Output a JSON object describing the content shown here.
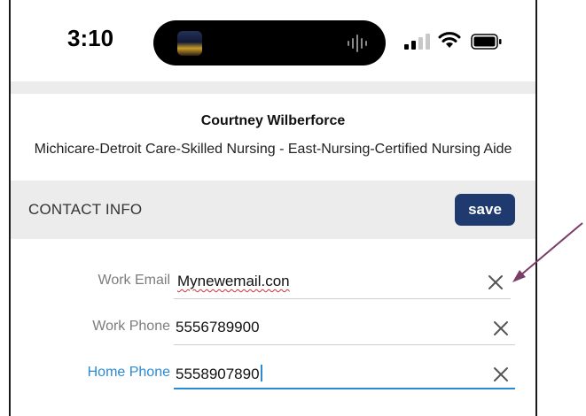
{
  "status_bar": {
    "time": "3:10",
    "icons": [
      "app-thumbnail-icon",
      "audio-wave-icon",
      "cellular-signal-icon",
      "wifi-icon",
      "battery-icon"
    ]
  },
  "profile": {
    "name": "Courtney Wilberforce",
    "organization": "Michicare-Detroit Care-Skilled Nursing - East-Nursing-Certified Nursing Aide"
  },
  "contact_section": {
    "title": "CONTACT INFO",
    "save_label": "save",
    "fields": [
      {
        "label": "Work Email",
        "value": "Mynewemail.con",
        "focused": false,
        "spellcheck_error": true
      },
      {
        "label": "Work Phone",
        "value": "5556789900",
        "focused": false
      },
      {
        "label": "Home Phone",
        "value": "5558907890",
        "focused": true
      }
    ]
  },
  "annotation": {
    "type": "arrow",
    "color": "#7a3d6a",
    "points_to": "work-email-clear-icon"
  },
  "colors": {
    "accent": "#2a8bd3",
    "save_button": "#1f3a6e",
    "section_background": "#ececec",
    "label_gray": "#7d7d7d"
  }
}
